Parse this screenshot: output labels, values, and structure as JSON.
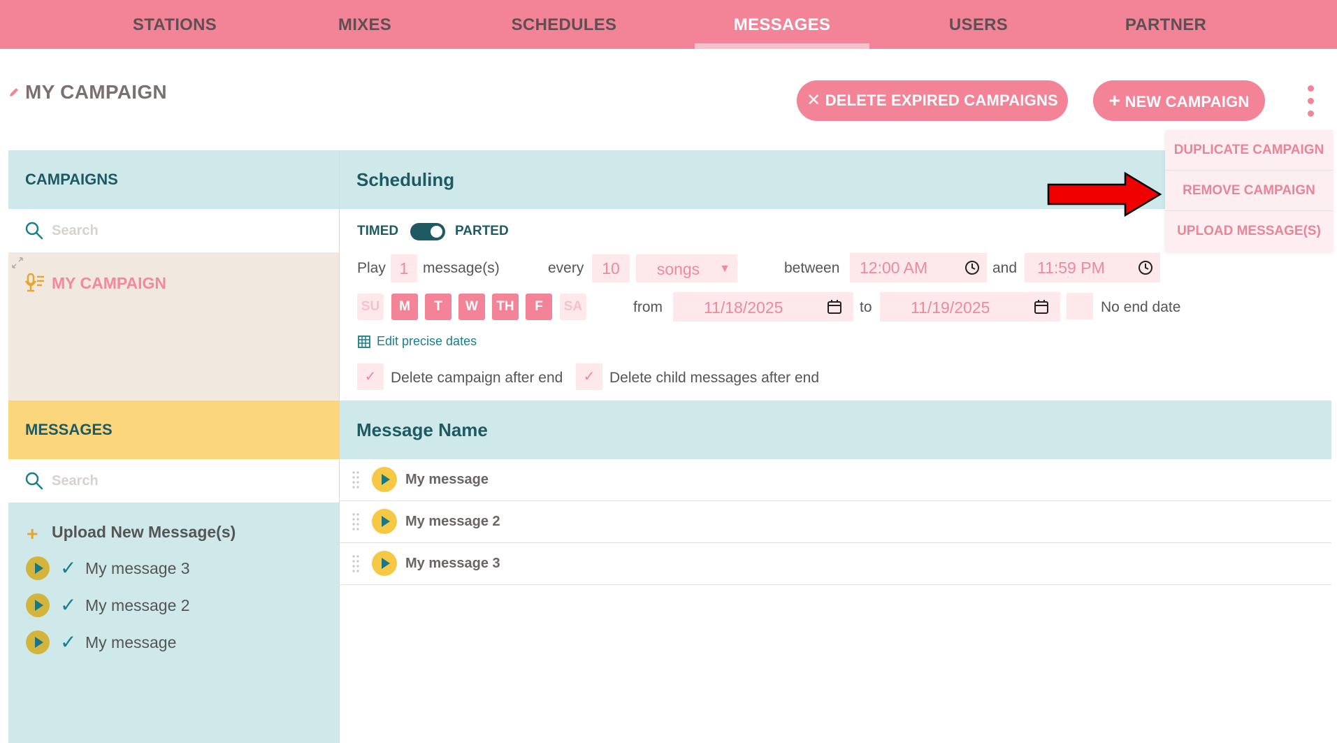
{
  "nav": {
    "tabs": [
      {
        "label": "STATIONS"
      },
      {
        "label": "MIXES"
      },
      {
        "label": "SCHEDULES"
      },
      {
        "label": "MESSAGES"
      },
      {
        "label": "USERS"
      },
      {
        "label": "PARTNER"
      }
    ],
    "active": "MESSAGES"
  },
  "header": {
    "title": "MY CAMPAIGN",
    "delete_expired_label": "DELETE EXPIRED CAMPAIGNS",
    "new_campaign_label": "NEW CAMPAIGN"
  },
  "menu": {
    "items": [
      {
        "label": "DUPLICATE CAMPAIGN"
      },
      {
        "label": "REMOVE CAMPAIGN"
      },
      {
        "label": "UPLOAD MESSAGE(S)"
      }
    ]
  },
  "campaigns": {
    "heading": "CAMPAIGNS",
    "search_placeholder": "Search",
    "items": [
      {
        "label": "MY CAMPAIGN"
      }
    ]
  },
  "messages_panel": {
    "heading": "MESSAGES",
    "search_placeholder": "Search",
    "upload_label": "Upload New Message(s)",
    "items": [
      {
        "label": "My message 3"
      },
      {
        "label": "My message 2"
      },
      {
        "label": "My message"
      }
    ]
  },
  "scheduling": {
    "heading": "Scheduling",
    "toggle_left": "TIMED",
    "toggle_right": "PARTED",
    "play_label": "Play",
    "play_count": "1",
    "messages_label": "message(s)",
    "every_label": "every",
    "every_count": "10",
    "unit": "songs",
    "between_label": "between",
    "start_time": "12:00 AM",
    "and_label": "and",
    "end_time": "11:59 PM",
    "days": [
      {
        "label": "SU",
        "on": false
      },
      {
        "label": "M",
        "on": true
      },
      {
        "label": "T",
        "on": true
      },
      {
        "label": "W",
        "on": true
      },
      {
        "label": "TH",
        "on": true
      },
      {
        "label": "F",
        "on": true
      },
      {
        "label": "SA",
        "on": false
      }
    ],
    "from_label": "from",
    "from_date": "11/18/2025",
    "to_label": "to",
    "to_date": "11/19/2025",
    "no_end_date_label": "No end date",
    "edit_dates_label": "Edit precise dates",
    "delete_after_end_label": "Delete campaign after end",
    "delete_children_label": "Delete child messages after end"
  },
  "message_table": {
    "heading": "Message Name",
    "rows": [
      {
        "name": "My message"
      },
      {
        "name": "My message 2"
      },
      {
        "name": "My message 3"
      }
    ]
  },
  "colors": {
    "brand_pink": "#f38497",
    "teal": "#1e5a63",
    "light_blue": "#cfe9eb",
    "yellow": "#fcd67d"
  }
}
